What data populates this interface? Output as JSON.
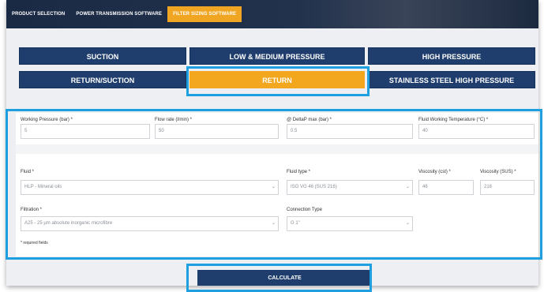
{
  "nav": {
    "items": [
      "PRODUCT SELECTION",
      "POWER TRANSMISSION SOFTWARE",
      "FILTER SIZING SOFTWARE"
    ],
    "active_index": 2
  },
  "categories": {
    "suction": "SUCTION",
    "low_medium": "LOW & MEDIUM PRESSURE",
    "high": "HIGH PRESSURE",
    "return_suction": "RETURN/SUCTION",
    "return": "RETURN",
    "stainless_high": "STAINLESS STEEL HIGH PRESSURE",
    "active": "RETURN"
  },
  "form": {
    "working_pressure": {
      "label": "Working Pressure (bar) *",
      "value": "5"
    },
    "flow_rate": {
      "label": "Flow rate (l/min) *",
      "value": "50"
    },
    "delta_p": {
      "label": "@ DeltaP max (bar) *",
      "value": "0.5"
    },
    "fluid_temp": {
      "label": "Fluid Working Temperature (°C) *",
      "value": "40"
    },
    "fluid": {
      "label": "Fluid *",
      "value": "HLP - Mineral oils"
    },
    "fluid_type": {
      "label": "Fluid type *",
      "value": "ISO VG 46 (SUS 216)"
    },
    "viscosity_cst": {
      "label": "Viscosity (cst) *",
      "value": "46"
    },
    "viscosity_sus": {
      "label": "Viscosity (SUS) *",
      "value": "216"
    },
    "filtration": {
      "label": "Filtration *",
      "value": "A25 - 25 µm absolute inorganic microfibre"
    },
    "connection_type": {
      "label": "Connection Type",
      "value": "G 1\""
    },
    "required_note": "* required fields"
  },
  "calculate_label": "CALCULATE",
  "colors": {
    "navy": "#1f3e6e",
    "accent": "#f2a71f",
    "highlight": "#1ea0e0",
    "background": "#eeeff2"
  }
}
